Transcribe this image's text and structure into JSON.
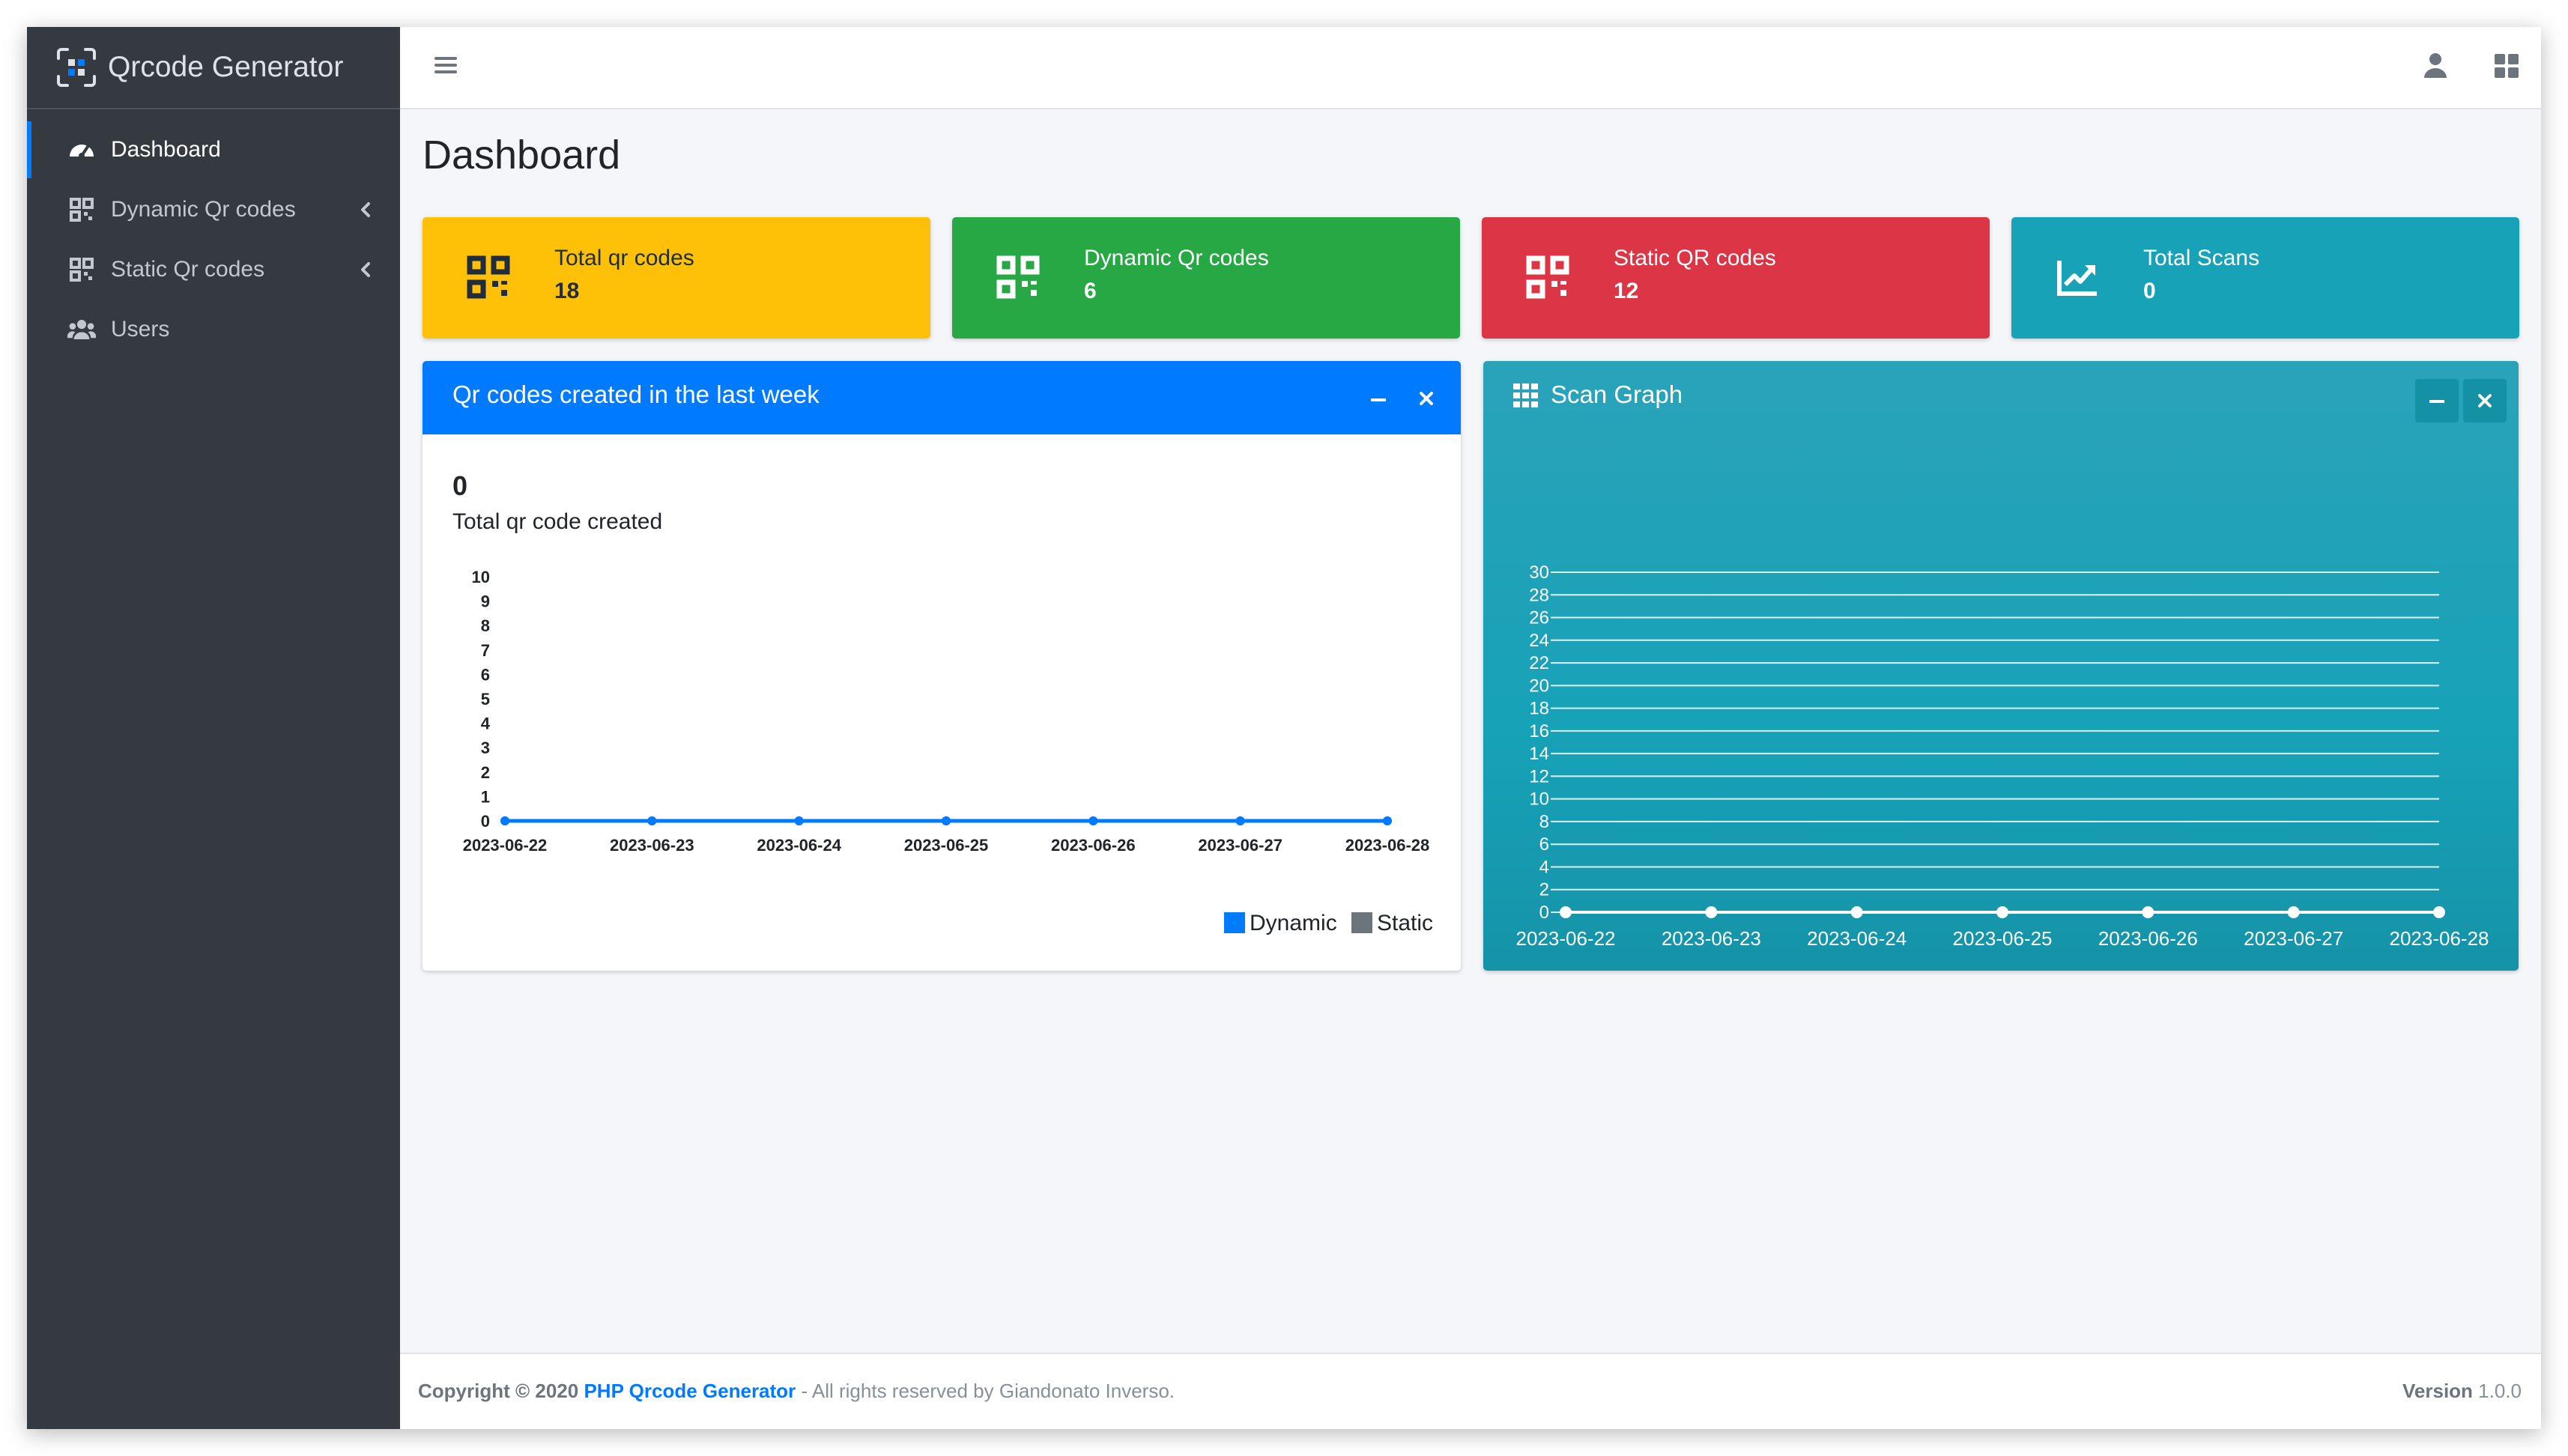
{
  "app": {
    "brand": "Qrcode Generator"
  },
  "sidebar": {
    "items": [
      {
        "label": "Dashboard",
        "icon": "tachometer-icon",
        "active": true
      },
      {
        "label": "Dynamic Qr codes",
        "icon": "qrcode-icon",
        "has_caret": true
      },
      {
        "label": "Static Qr codes",
        "icon": "qrcode-icon",
        "has_caret": true
      },
      {
        "label": "Users",
        "icon": "users-icon"
      }
    ]
  },
  "header": {
    "menu_icon": "hamburger-icon",
    "user_icon": "user-icon",
    "apps_icon": "apps-grid-icon"
  },
  "page": {
    "title": "Dashboard"
  },
  "info_boxes": [
    {
      "label": "Total qr codes",
      "value": "18",
      "color": "#ffc107",
      "icon": "qrcode-icon"
    },
    {
      "label": "Dynamic Qr codes",
      "value": "6",
      "color": "#28a745",
      "icon": "qrcode-icon"
    },
    {
      "label": "Static QR codes",
      "value": "12",
      "color": "#dc3545",
      "icon": "qrcode-icon"
    },
    {
      "label": "Total Scans",
      "value": "0",
      "color": "#17a2b8",
      "icon": "chart-line-icon"
    }
  ],
  "weekly_card": {
    "title": "Qr codes created in the last week",
    "total": "0",
    "subtitle": "Total qr code created"
  },
  "scan_card": {
    "title": "Scan Graph",
    "icon": "th-icon"
  },
  "footer": {
    "copyright": "Copyright © 2020",
    "link": "PHP Qrcode Generator",
    "rights": "- All rights reserved by Giandonato Inverso.",
    "version_label": "Version",
    "version": "1.0.0"
  },
  "colors": {
    "primary": "#007bff",
    "sidebar": "#343a40",
    "info": "#17a2b8",
    "static_series": "#6c757d"
  },
  "chart_data": [
    {
      "type": "line",
      "x": [
        "2023-06-22",
        "2023-06-23",
        "2023-06-24",
        "2023-06-25",
        "2023-06-26",
        "2023-06-27",
        "2023-06-28"
      ],
      "series": [
        {
          "name": "Dynamic",
          "values": [
            0,
            0,
            0,
            0,
            0,
            0,
            0
          ],
          "color": "#007bff"
        },
        {
          "name": "Static",
          "values": [
            0,
            0,
            0,
            0,
            0,
            0,
            0
          ],
          "color": "#6c757d"
        }
      ],
      "yticks": [
        0,
        1,
        2,
        3,
        4,
        5,
        6,
        7,
        8,
        9,
        10
      ],
      "ylim": [
        0,
        10
      ],
      "legend": "bottom-right",
      "grid": false
    },
    {
      "type": "line",
      "x": [
        "2023-06-22",
        "2023-06-23",
        "2023-06-24",
        "2023-06-25",
        "2023-06-26",
        "2023-06-27",
        "2023-06-28"
      ],
      "series": [
        {
          "values": [
            0,
            0,
            0,
            0,
            0,
            0,
            0
          ],
          "color": "#ffffff"
        }
      ],
      "yticks": [
        0,
        2,
        4,
        6,
        8,
        10,
        12,
        14,
        16,
        18,
        20,
        22,
        24,
        26,
        28,
        30
      ],
      "ylim": [
        0,
        30
      ],
      "grid": true
    }
  ]
}
